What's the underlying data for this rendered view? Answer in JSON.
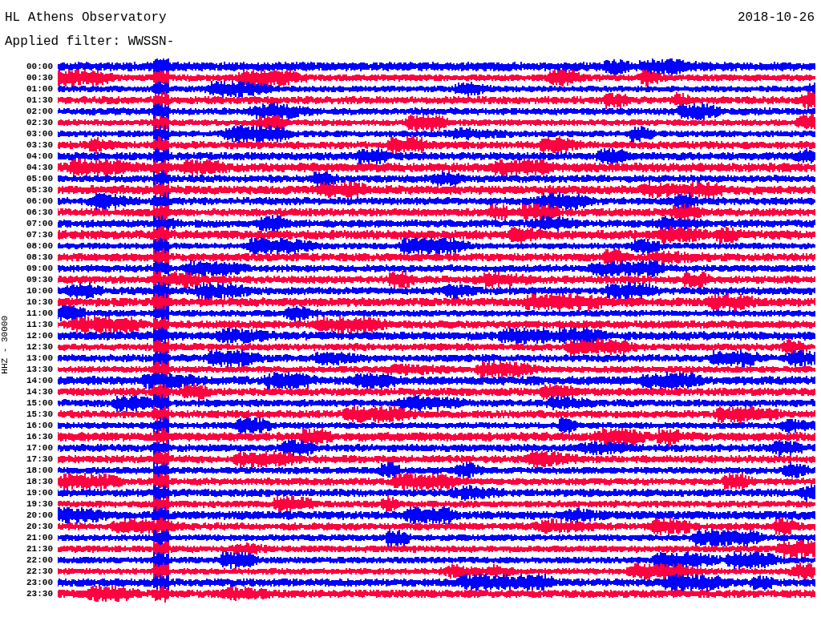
{
  "title": "HL Athens Observatory",
  "filter": "Applied filter: WWSSN-",
  "date": "2018-10-26",
  "channel_label": "HHZ - 30000",
  "traces": [
    {
      "time": "00:00",
      "color": "#0000ff"
    },
    {
      "time": "00:30",
      "color": "#ff0040"
    },
    {
      "time": "01:00",
      "color": "#0000ff"
    },
    {
      "time": "01:30",
      "color": "#ff0040"
    },
    {
      "time": "02:00",
      "color": "#0000ff"
    },
    {
      "time": "02:30",
      "color": "#ff0040"
    },
    {
      "time": "03:00",
      "color": "#0000ff"
    },
    {
      "time": "03:30",
      "color": "#ff0040"
    },
    {
      "time": "04:00",
      "color": "#0000ff"
    },
    {
      "time": "04:30",
      "color": "#ff0040"
    },
    {
      "time": "05:00",
      "color": "#0000ff"
    },
    {
      "time": "05:30",
      "color": "#ff0040"
    },
    {
      "time": "06:00",
      "color": "#0000ff"
    },
    {
      "time": "06:30",
      "color": "#ff0040"
    },
    {
      "time": "07:00",
      "color": "#0000ff"
    },
    {
      "time": "07:30",
      "color": "#ff0040"
    },
    {
      "time": "08:00",
      "color": "#0000ff"
    },
    {
      "time": "08:30",
      "color": "#ff0040"
    },
    {
      "time": "09:00",
      "color": "#0000ff"
    },
    {
      "time": "09:30",
      "color": "#ff0040"
    },
    {
      "time": "10:00",
      "color": "#0000ff"
    },
    {
      "time": "10:30",
      "color": "#ff0040"
    },
    {
      "time": "11:00",
      "color": "#0000ff"
    },
    {
      "time": "11:30",
      "color": "#ff0040"
    },
    {
      "time": "12:00",
      "color": "#0000ff"
    },
    {
      "time": "12:30",
      "color": "#ff0040"
    },
    {
      "time": "13:00",
      "color": "#0000ff"
    },
    {
      "time": "13:30",
      "color": "#ff0040"
    },
    {
      "time": "14:00",
      "color": "#0000ff"
    },
    {
      "time": "14:30",
      "color": "#ff0040"
    },
    {
      "time": "15:00",
      "color": "#0000ff"
    },
    {
      "time": "15:30",
      "color": "#ff0040"
    },
    {
      "time": "16:00",
      "color": "#0000ff"
    },
    {
      "time": "16:30",
      "color": "#ff0040"
    },
    {
      "time": "17:00",
      "color": "#0000ff"
    },
    {
      "time": "17:30",
      "color": "#ff0040"
    },
    {
      "time": "18:00",
      "color": "#0000ff"
    },
    {
      "time": "18:30",
      "color": "#ff0040"
    },
    {
      "time": "19:00",
      "color": "#0000ff"
    },
    {
      "time": "19:30",
      "color": "#ff0040"
    },
    {
      "time": "20:00",
      "color": "#0000ff"
    },
    {
      "time": "20:30",
      "color": "#ff0040"
    },
    {
      "time": "21:00",
      "color": "#0000ff"
    },
    {
      "time": "21:30",
      "color": "#ff0040"
    },
    {
      "time": "22:00",
      "color": "#0000ff"
    },
    {
      "time": "22:30",
      "color": "#ff0040"
    },
    {
      "time": "23:00",
      "color": "#0000ff"
    },
    {
      "time": "23:30",
      "color": "#ff0040"
    }
  ]
}
